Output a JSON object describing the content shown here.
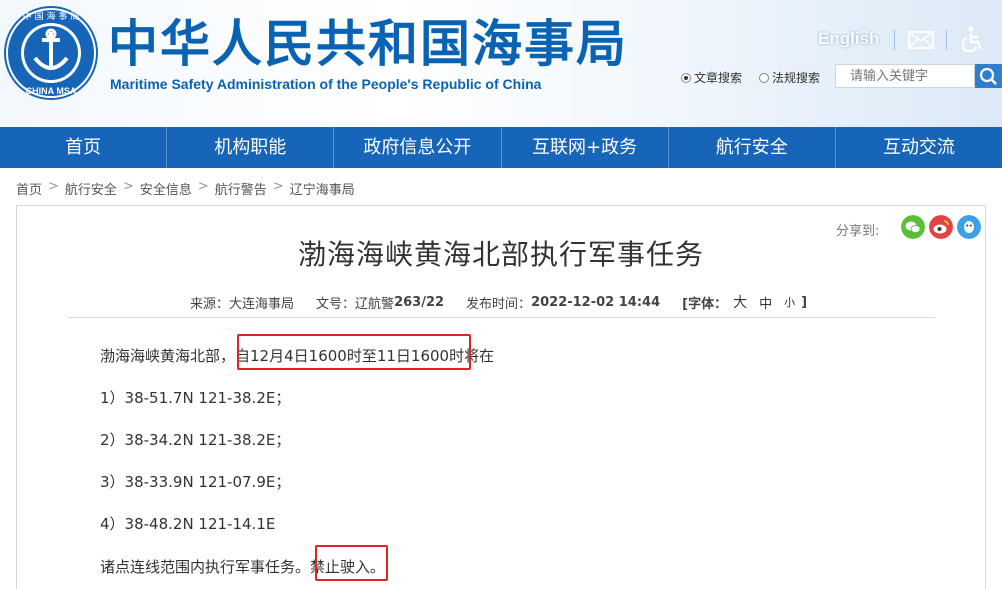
{
  "header": {
    "site_title": "中华人民共和国海事局",
    "site_subtitle": "Maritime Safety Administration of the People's Republic of China",
    "logo_text_top": "中 国 海 事 局",
    "logo_text_bottom": "CHINA MSA",
    "lang_link": "English",
    "search": {
      "options": [
        "文章搜索",
        "法规搜索"
      ],
      "selected": "文章搜索",
      "placeholder": "请输入关键字"
    }
  },
  "nav": {
    "items": [
      "首页",
      "机构职能",
      "政府信息公开",
      "互联网+政务",
      "航行安全",
      "互动交流"
    ]
  },
  "breadcrumb": [
    "首页",
    "航行安全",
    "安全信息",
    "航行警告",
    "辽宁海事局"
  ],
  "article": {
    "share_label": "分享到:",
    "title": "渤海海峡黄海北部执行军事任务",
    "meta": {
      "source_label": "来源：",
      "source": "大连海事局",
      "doc_label": "文号：",
      "doc_prefix": "辽航警",
      "doc_num": "263/22",
      "time_label": "发布时间：",
      "time": "2022-12-02 14:44",
      "font_open": "[字体：",
      "font_large": "大",
      "font_medium": "中",
      "font_small": "小",
      "font_close": "]"
    },
    "intro_prefix": "渤海海峡黄海北部，",
    "intro_highlight": "自12月4日1600时至11日1600时",
    "intro_suffix": "将在",
    "points": [
      "1）38-51.7N    121-38.2E；",
      "2）38-34.2N    121-38.2E；",
      "3）38-33.9N    121-07.9E；",
      "4）38-48.2N    121-14.1E"
    ],
    "closing_prefix": "诸点连线范围内执行军事任务。",
    "closing_highlight": "禁止驶入",
    "closing_suffix": "。"
  },
  "colors": {
    "brand_blue": "#0a63b2",
    "nav_blue": "#1665b8",
    "highlight_red": "#e02424"
  }
}
